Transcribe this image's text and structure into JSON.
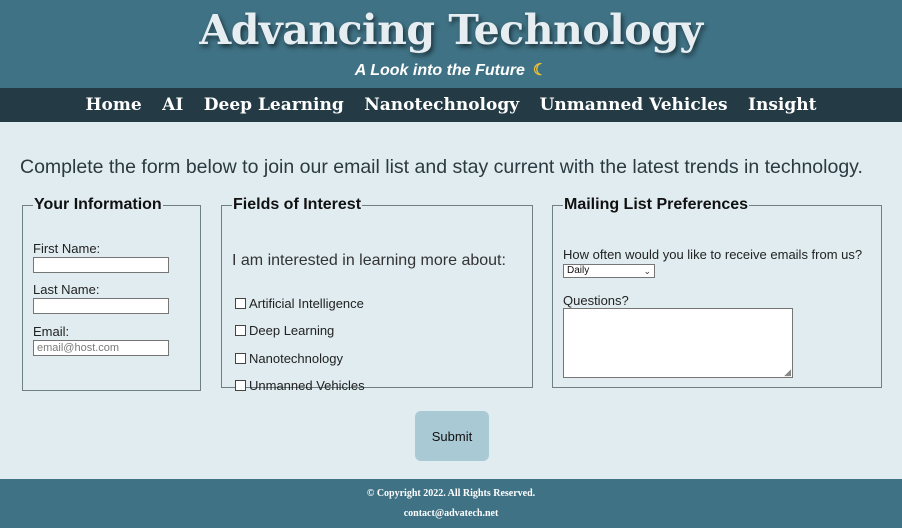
{
  "header": {
    "title": "Advancing Technology",
    "tagline": "A Look into the Future",
    "tagline_icon": "crescent-moon-icon",
    "accent_color": "#3f7285"
  },
  "nav": {
    "items": [
      "Home",
      "AI",
      "Deep Learning",
      "Nanotechnology",
      "Unmanned Vehicles",
      "Insight"
    ]
  },
  "intro": "Complete the form below to join our email list and stay current with the latest trends in technology.",
  "info": {
    "legend": "Your Information",
    "first_name_label": "First Name:",
    "first_name_value": "",
    "last_name_label": "Last Name:",
    "last_name_value": "",
    "email_label": "Email:",
    "email_placeholder": "email@host.com"
  },
  "interests": {
    "legend": "Fields of Interest",
    "lead": "I am interested in learning more about:",
    "options": [
      "Artificial Intelligence",
      "Deep Learning",
      "Nanotechnology",
      "Unmanned Vehicles"
    ]
  },
  "mailing": {
    "legend": "Mailing List Preferences",
    "frequency_label": "How often would you like to receive emails from us?",
    "frequency_value": "Daily",
    "questions_label": "Questions?"
  },
  "submit_label": "Submit",
  "footer": {
    "copyright": "© Copyright 2022. All Rights Reserved.",
    "contact": "contact@advatech.net"
  }
}
